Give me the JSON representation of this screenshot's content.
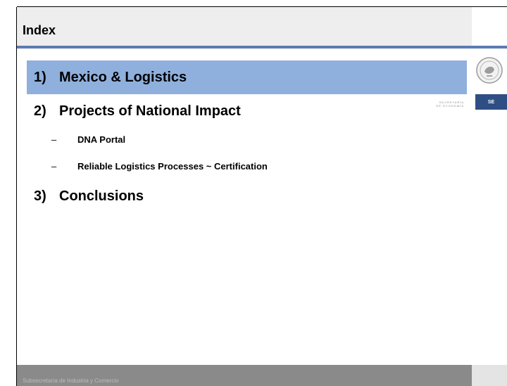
{
  "slide": {
    "title": "Index",
    "items": [
      {
        "num": "1)",
        "label": "Mexico & Logistics"
      },
      {
        "num": "2)",
        "label": "Projects of National Impact"
      },
      {
        "num": "3)",
        "label": "Conclusions"
      }
    ],
    "subitems": [
      {
        "dash": "–",
        "label": "DNA Portal"
      },
      {
        "dash": "–",
        "label": "Reliable Logistics Processes ~ Certification"
      }
    ]
  },
  "logo": {
    "text_line1": "SECRETARÍA",
    "text_line2": "DE ECONOMÍA",
    "badge": "SE"
  },
  "footer": {
    "text": "Subsecretaría de Industria y Comercio"
  },
  "colors": {
    "accent_rule": "#5b7bb4",
    "highlight": "#8fb0dd",
    "footer": "#8a8a8a"
  }
}
